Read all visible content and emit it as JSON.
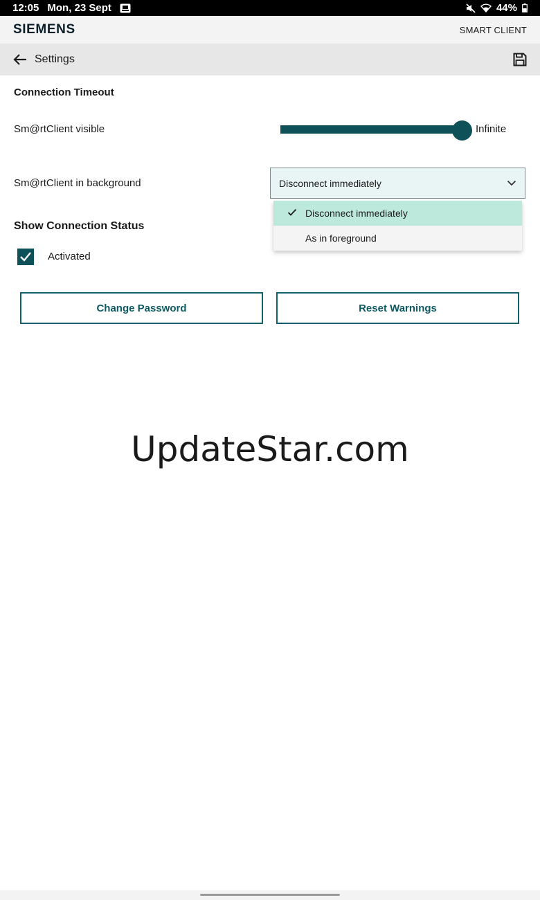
{
  "status_bar": {
    "time": "12:05",
    "date": "Mon, 23 Sept",
    "battery": "44%",
    "icons": [
      "notification-icon",
      "mute-icon",
      "wifi-icon",
      "battery-icon"
    ]
  },
  "brand": {
    "logo": "SIEMENS",
    "app_name": "SMART CLIENT"
  },
  "title_bar": {
    "title": "Settings",
    "back_icon": "arrow-left-icon",
    "save_icon": "save-icon"
  },
  "connection_timeout": {
    "heading": "Connection Timeout",
    "visible": {
      "label": "Sm@rtClient visible",
      "slider_value": "Infinite",
      "slider_fraction": 1.0
    },
    "background": {
      "label": "Sm@rtClient in background",
      "selected": "Disconnect immediately",
      "options": [
        "Disconnect immediately",
        "As in foreground"
      ]
    }
  },
  "connection_status": {
    "heading": "Show Connection Status",
    "checkbox_label": "Activated",
    "checked": true
  },
  "buttons": {
    "change_password": "Change Password",
    "reset_warnings": "Reset Warnings"
  },
  "watermark": "UpdateStar.com",
  "colors": {
    "accent": "#0e5158",
    "selected_option": "#bde9dd",
    "select_bg": "#e9f4f5"
  }
}
